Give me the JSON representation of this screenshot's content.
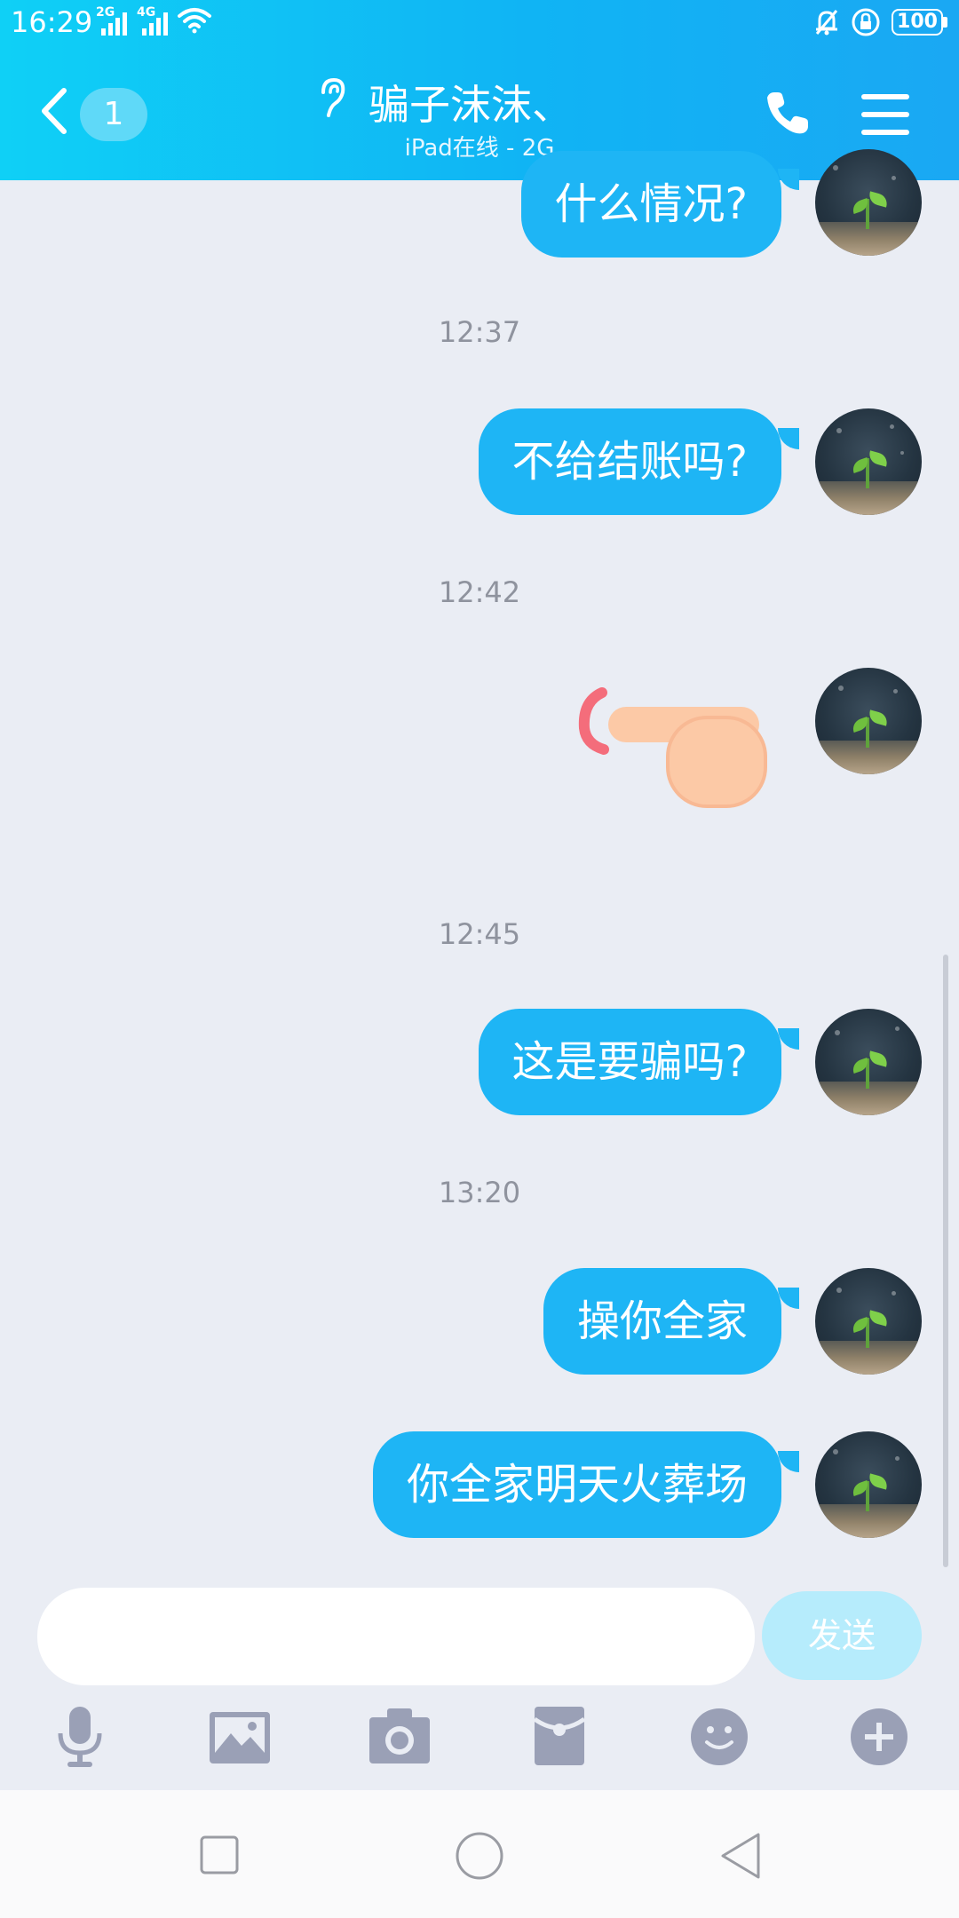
{
  "status_bar": {
    "time": "16:29",
    "network_1": "2G",
    "network_2": "4G",
    "battery": "100"
  },
  "header": {
    "back_count": "1",
    "contact_name": "骗子沫沫、",
    "contact_status": "iPad在线 - 2G"
  },
  "messages": [
    {
      "type": "text",
      "text": "什么情况?"
    },
    {
      "type": "time",
      "text": "12:37"
    },
    {
      "type": "text",
      "text": "不给结账吗?"
    },
    {
      "type": "time",
      "text": "12:42"
    },
    {
      "type": "sticker",
      "icon": "pointing-hand-sticker"
    },
    {
      "type": "time",
      "text": "12:45"
    },
    {
      "type": "text",
      "text": "这是要骗吗?"
    },
    {
      "type": "time",
      "text": "13:20"
    },
    {
      "type": "text",
      "text": "操你全家"
    },
    {
      "type": "text",
      "text": "你全家明天火葬场"
    }
  ],
  "input": {
    "value": "",
    "send_label": "发送"
  },
  "toolbar": [
    "microphone-icon",
    "image-icon",
    "camera-icon",
    "red-packet-icon",
    "emoji-icon",
    "plus-icon"
  ],
  "colors": {
    "header_start": "#0fd0f6",
    "header_end": "#1aa8f3",
    "bubble": "#1eb5f5",
    "background": "#eaedf4",
    "send_button": "#b6ecfc",
    "tool_icon": "#9aa0b6"
  }
}
